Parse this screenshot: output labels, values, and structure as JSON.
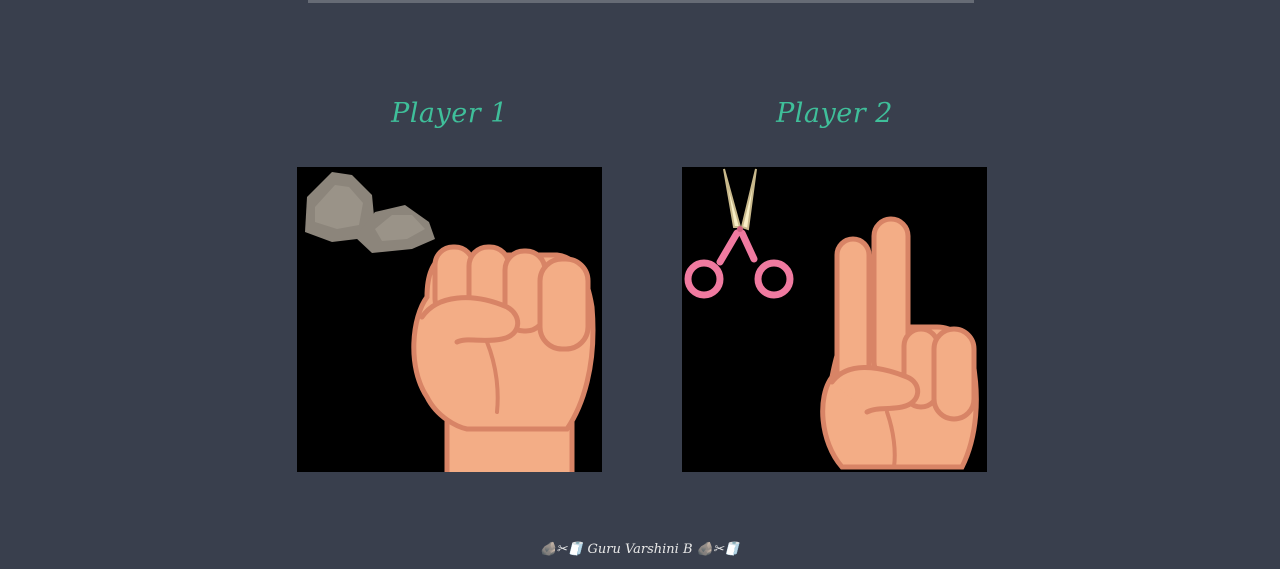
{
  "players": [
    {
      "title": "Player 1",
      "choice": "rock"
    },
    {
      "title": "Player 2",
      "choice": "scissors"
    }
  ],
  "footer": {
    "left_icons": "🪨✂🧻",
    "author": "Guru Varshini B",
    "right_icons": "🪨✂🧻"
  },
  "colors": {
    "background": "#393f4d",
    "title": "#3fbf9a",
    "image_bg": "#000000",
    "skin": "#f3ad86",
    "skin_outline": "#d88466",
    "rock": "#8c857b",
    "scissor_handle": "#f07aa0",
    "scissor_blade": "#f9efc6"
  }
}
